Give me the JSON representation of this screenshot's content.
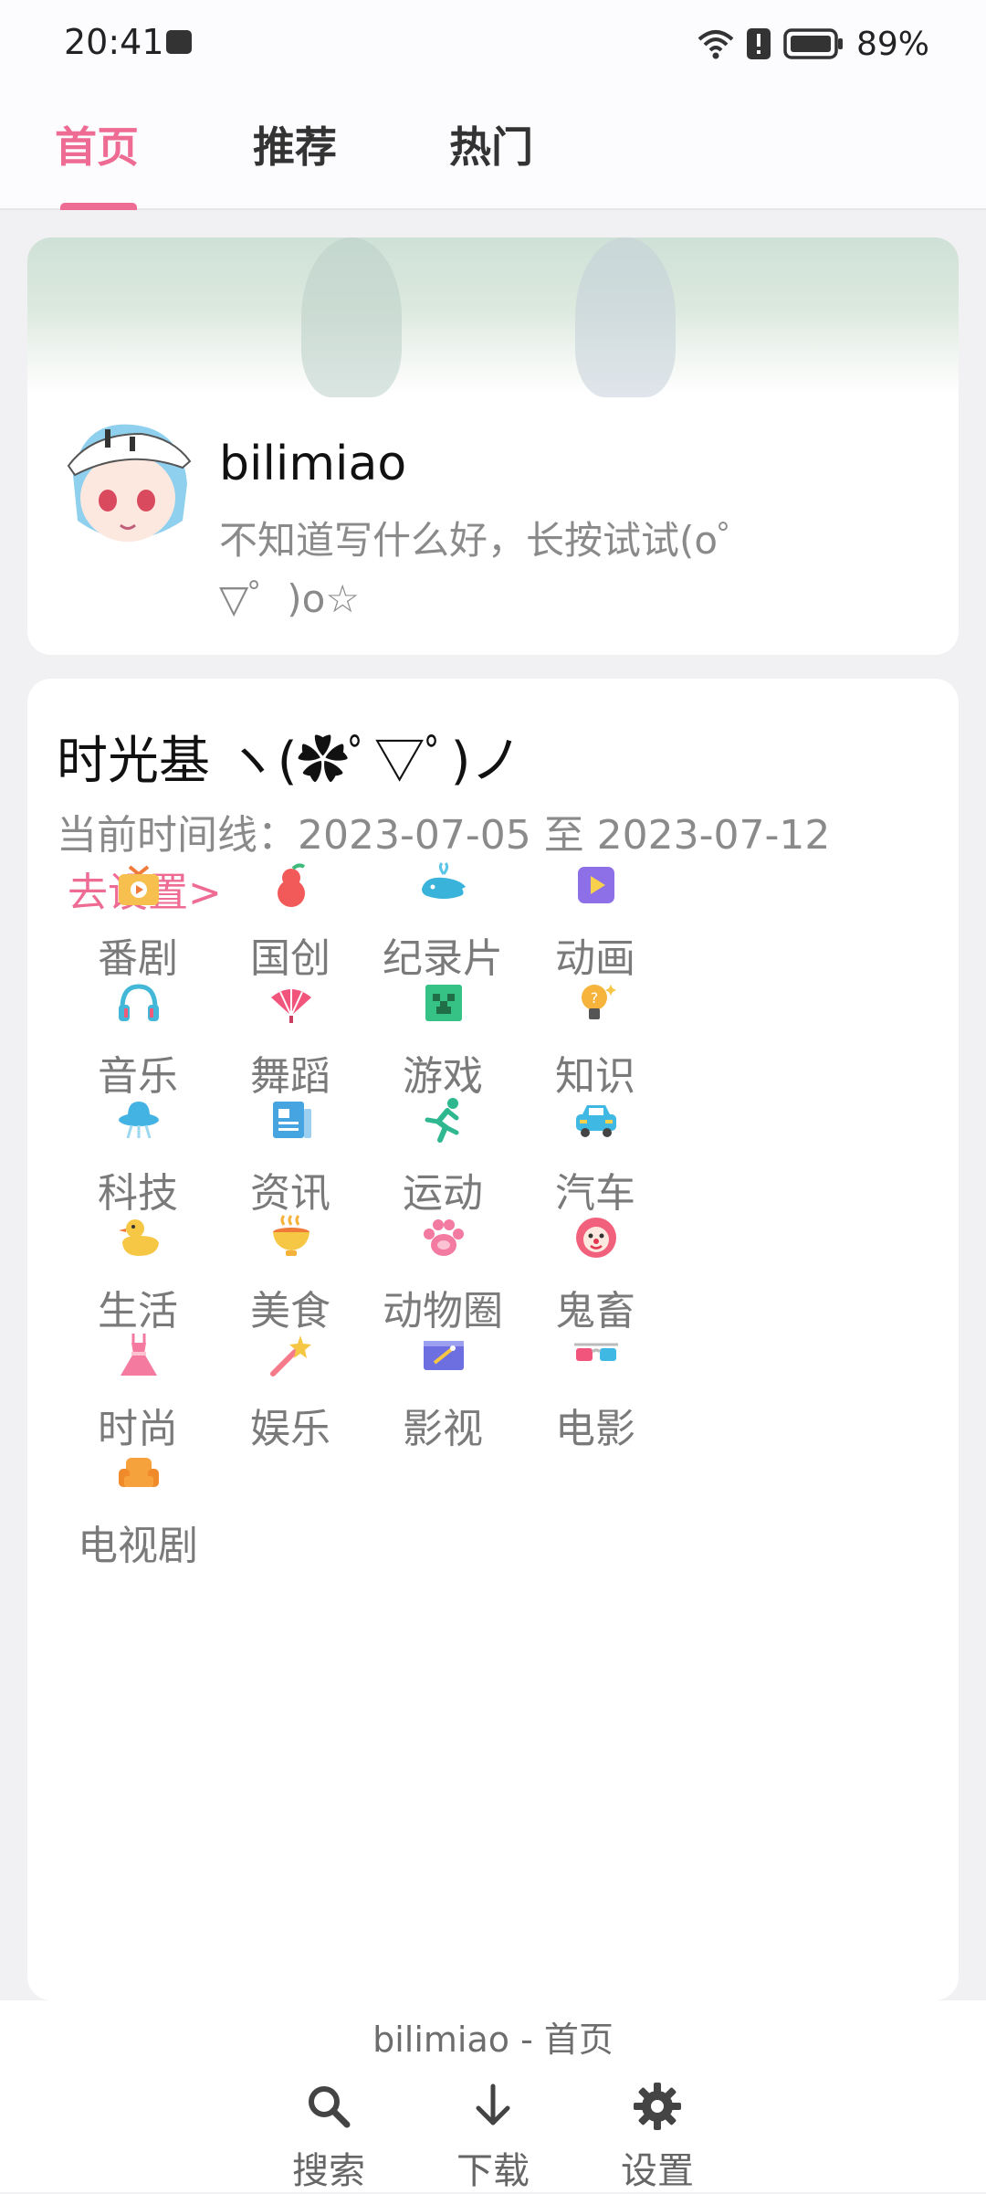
{
  "status_bar": {
    "time": "20:41",
    "battery": "89%"
  },
  "tabs": [
    {
      "label": "首页",
      "active": true
    },
    {
      "label": "推荐",
      "active": false
    },
    {
      "label": "热门",
      "active": false
    }
  ],
  "profile": {
    "username": "bilimiao",
    "sign": "不知道写什么好，长按试试(o゜▽゜)o☆"
  },
  "timeline": {
    "title": "时光基  ヽ(✿ﾟ▽ﾟ)ノ",
    "range_prefix": "当前时间线：",
    "range": "2023-07-05 至 2023-07-12",
    "setting_link": "去设置>",
    "categories": [
      {
        "label": "番剧",
        "icon": "tv-icon",
        "color": "#f7b84a"
      },
      {
        "label": "国创",
        "icon": "gourd-icon",
        "color": "#f25a5a"
      },
      {
        "label": "纪录片",
        "icon": "whale-icon",
        "color": "#39b3d9"
      },
      {
        "label": "动画",
        "icon": "play-square-icon",
        "color": "#8d70e8"
      },
      {
        "label": "音乐",
        "icon": "headphones-icon",
        "color": "#42b7d8"
      },
      {
        "label": "舞蹈",
        "icon": "fan-icon",
        "color": "#f2557b"
      },
      {
        "label": "游戏",
        "icon": "creeper-icon",
        "color": "#35c284"
      },
      {
        "label": "知识",
        "icon": "lightbulb-icon",
        "color": "#f6b43c"
      },
      {
        "label": "科技",
        "icon": "ufo-icon",
        "color": "#42b3e2"
      },
      {
        "label": "资讯",
        "icon": "newspaper-icon",
        "color": "#46a4e0"
      },
      {
        "label": "运动",
        "icon": "runner-icon",
        "color": "#2fb88f"
      },
      {
        "label": "汽车",
        "icon": "car-icon",
        "color": "#3fb9e3"
      },
      {
        "label": "生活",
        "icon": "duck-icon",
        "color": "#f6c744"
      },
      {
        "label": "美食",
        "icon": "bowl-icon",
        "color": "#f6b33c"
      },
      {
        "label": "动物圈",
        "icon": "paw-icon",
        "color": "#f37aa0"
      },
      {
        "label": "鬼畜",
        "icon": "clown-icon",
        "color": "#f2617c"
      },
      {
        "label": "时尚",
        "icon": "dress-icon",
        "color": "#f57aa0"
      },
      {
        "label": "娱乐",
        "icon": "wand-icon",
        "color": "#f5a844"
      },
      {
        "label": "影视",
        "icon": "clapper-icon",
        "color": "#6d6fe0"
      },
      {
        "label": "电影",
        "icon": "3d-glasses-icon",
        "color": "#3fb9e3"
      },
      {
        "label": "电视剧",
        "icon": "sofa-icon",
        "color": "#f6a23c"
      }
    ]
  },
  "bottom_bar": {
    "title": "bilimiao - 首页",
    "buttons": [
      {
        "label": "搜索",
        "icon": "search-icon"
      },
      {
        "label": "下载",
        "icon": "download-icon"
      },
      {
        "label": "设置",
        "icon": "gear-icon"
      }
    ]
  },
  "colors": {
    "accent": "#ee6b93",
    "muted_text": "#8a8a8a",
    "card": "#ffffff",
    "background": "#f1f1f3"
  }
}
